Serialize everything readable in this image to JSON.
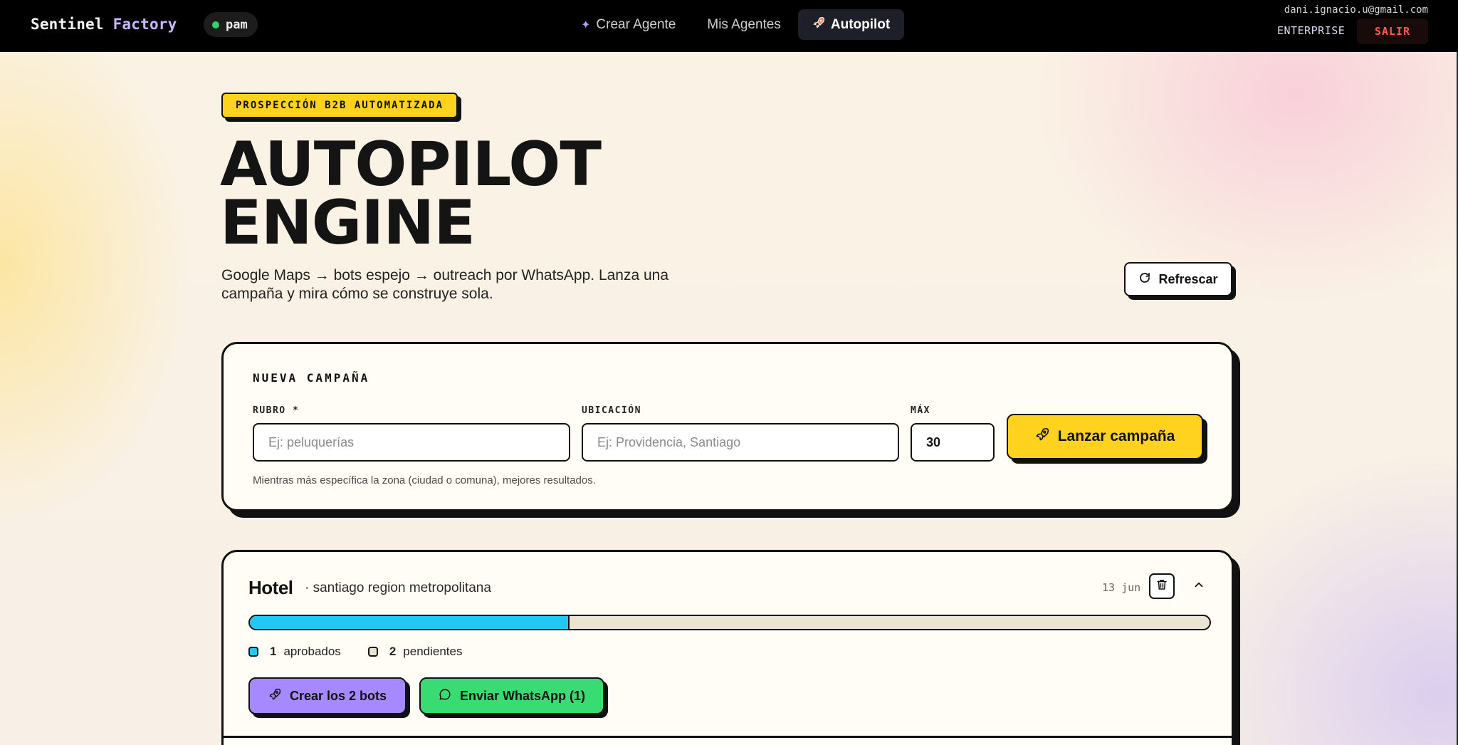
{
  "header": {
    "brand_first": "Sentinel",
    "brand_second": "Factory",
    "user": "pam",
    "nav": [
      {
        "label": "Crear Agente",
        "icon": "sparkle-icon"
      },
      {
        "label": "Mis Agentes"
      },
      {
        "label": "Autopilot",
        "icon": "rocket-icon",
        "active": true
      }
    ],
    "email": "dani.ignacio.u@gmail.com",
    "plan": "ENTERPRISE",
    "logout": "SALIR"
  },
  "hero": {
    "tag": "PROSPECCIÓN B2B AUTOMATIZADA",
    "title_line1": "AUTOPILOT",
    "title_line2": "ENGINE",
    "subtitle": "Google Maps → bots espejo → outreach por WhatsApp. Lanza una campaña y mira cómo se construye sola.",
    "refresh": "Refrescar"
  },
  "new_campaign": {
    "title": "NUEVA CAMPAÑA",
    "rubro_label": "RUBRO *",
    "rubro_placeholder": "Ej: peluquerías",
    "ubicacion_label": "UBICACIÓN",
    "ubicacion_placeholder": "Ej: Providencia, Santiago",
    "max_label": "MÁX",
    "max_value": "30",
    "launch": "Lanzar campaña",
    "hint": "Mientras más específica la zona (ciudad o comuna), mejores resultados."
  },
  "campaign": {
    "title": "Hotel",
    "location": "· santiago region metropolitana",
    "date": "13 jun",
    "progress_approved_fraction": 0.333,
    "approved_count": "1",
    "approved_label": "aprobados",
    "pending_count": "2",
    "pending_label": "pendientes",
    "create_bots": "Crear los 2 bots",
    "send_whatsapp": "Enviar WhatsApp (1)"
  },
  "colors": {
    "accent_yellow": "#ffd21f",
    "progress_cyan": "#22c8ef",
    "purple": "#a688ff",
    "green": "#38dc73",
    "danger": "#ff5a4d"
  }
}
